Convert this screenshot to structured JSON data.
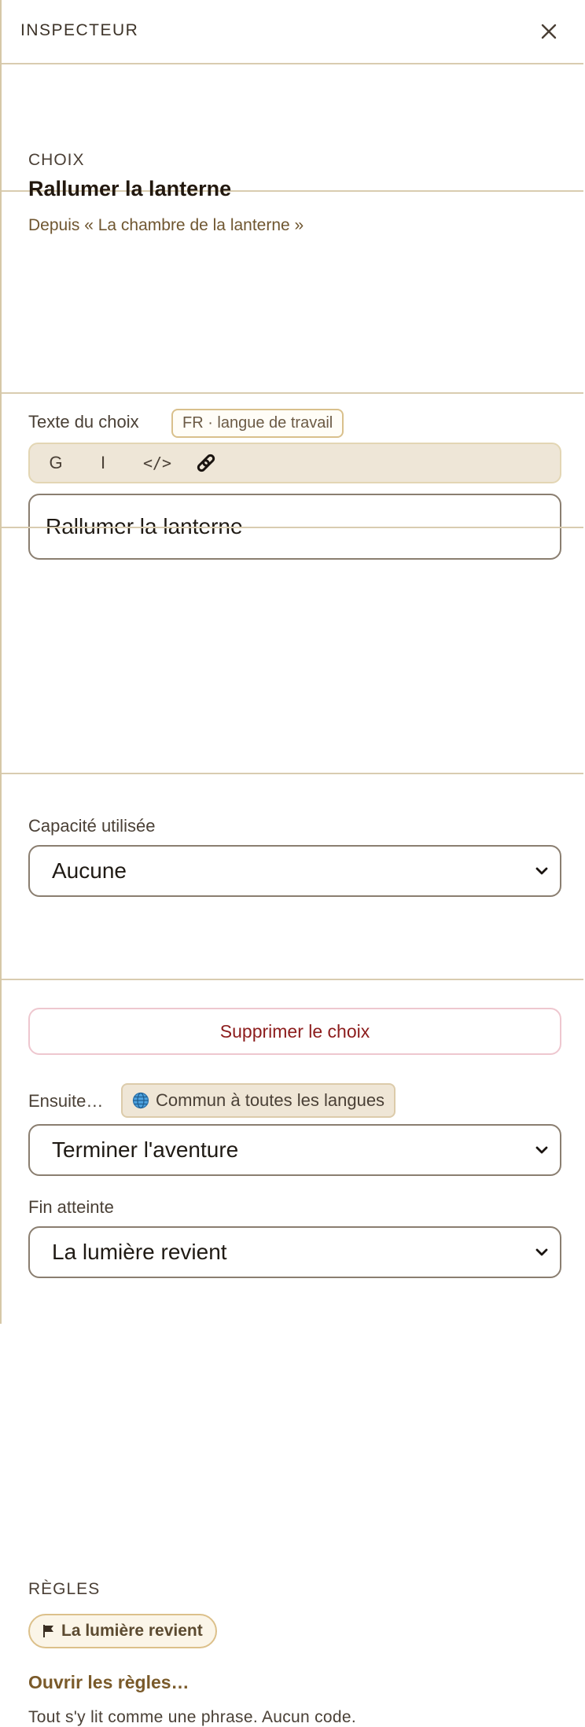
{
  "header": {
    "title": "INSPECTEUR",
    "close_icon": "close-icon"
  },
  "choice": {
    "kind_label": "CHOIX",
    "title": "Rallumer la lanterne",
    "from": "Depuis « La chambre de la lanterne »"
  },
  "text_field": {
    "label": "Texte du choix",
    "lang_badge": "FR · langue de travail",
    "toolbar": {
      "bold": "G",
      "italic": "I",
      "code": "</>",
      "link_icon": "link-icon"
    },
    "value": "Rallumer la lanterne"
  },
  "capacity": {
    "label": "Capacité utilisée",
    "selected": "Aucune"
  },
  "next": {
    "label": "Ensuite…",
    "common_badge": "Commun à toutes les langues",
    "selected": "Terminer l'aventure"
  },
  "ending": {
    "label": "Fin atteinte",
    "selected": "La lumière revient"
  },
  "rules": {
    "label": "RÈGLES",
    "chip": "La lumière revient",
    "open_link": "Ouvrir les règles…",
    "hint": "Tout s'y lit comme une phrase. Aucun code."
  },
  "actions": {
    "delete": "Supprimer le choix"
  },
  "colors": {
    "accent": "#7a5a2a",
    "danger": "#8c1c1c",
    "border": "#d9ccb0",
    "toolbar_bg": "#eee6d7"
  }
}
